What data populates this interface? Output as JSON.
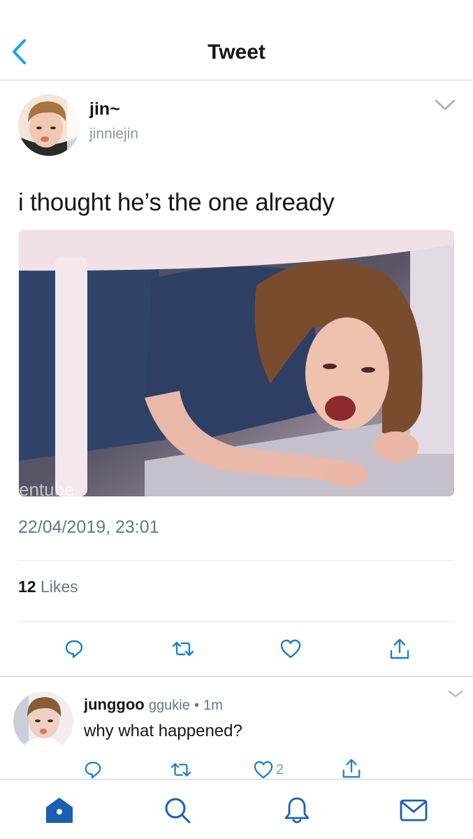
{
  "header": {
    "title": "Tweet",
    "back_icon": "chevron-left-icon"
  },
  "tweet": {
    "display_name": "jin~",
    "handle": "jinniejin",
    "text": "i thought he’s the one already",
    "media_watermark": "entube",
    "timestamp": "22/04/2019, 23:01",
    "likes_count": "12",
    "likes_label": "Likes",
    "actions": [
      "reply-icon",
      "retweet-icon",
      "heart-icon",
      "share-icon"
    ]
  },
  "reply": {
    "display_name": "junggoo",
    "handle": "ggukie",
    "separator": "•",
    "time": "1m",
    "text": "why what happened?",
    "like_count": "2"
  },
  "tabbar": {
    "items": [
      "home-icon",
      "search-icon",
      "notifications-icon",
      "messages-icon"
    ]
  },
  "colors": {
    "accent": "#1da1f2",
    "tabbar_active": "#1b5fb3",
    "secondary_text": "#657786",
    "divider": "#e1e8ed"
  }
}
